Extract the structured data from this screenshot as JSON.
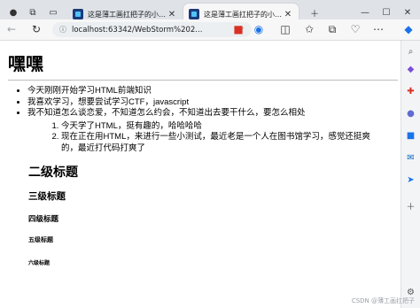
{
  "browser": {
    "tabs": [
      {
        "title": "这是薄工画扛把子的小黑屋",
        "active": false
      },
      {
        "title": "这是薄工画扛把子的小黑屋",
        "active": true
      }
    ],
    "address": "localhost:63342/WebStorm%202..."
  },
  "page": {
    "h1": "嘿嘿",
    "ul": [
      "今天刚刚开始学习HTML前端知识",
      "我喜欢学习，想要尝试学习CTF，javascript",
      "我不知道怎么谈恋爱，不知道怎么约会，不知道出去要干什么，要怎么相处"
    ],
    "ol": [
      "今天学了HTML，挺有趣的，哈哈哈哈",
      "现在正在用HTML，来进行一些小测试，最近老是一个人在图书馆学习，感觉还挺爽的，最近打代码打爽了"
    ],
    "h2": "二级标题",
    "h3": "三级标题",
    "h4": "四级标题",
    "h5": "五级标题",
    "h6": "六级标题"
  },
  "watermark": "CSDN @薄工画扛把子"
}
